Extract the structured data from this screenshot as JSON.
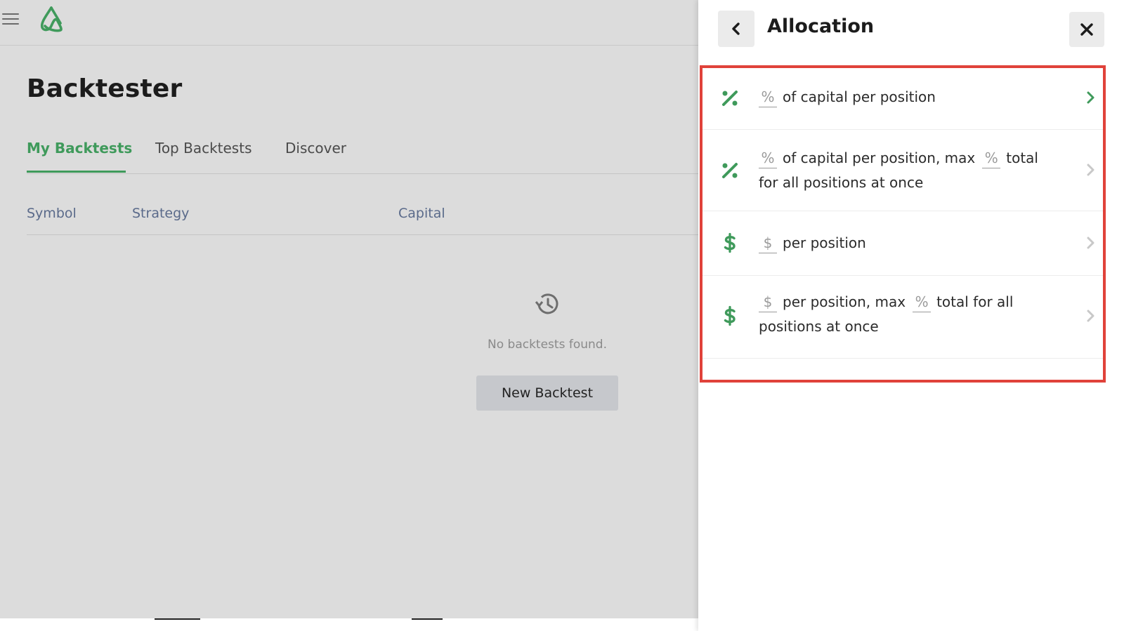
{
  "app": {
    "page_title": "Backtester",
    "tabs": [
      {
        "label": "My Backtests",
        "active": true
      },
      {
        "label": "Top Backtests",
        "active": false
      },
      {
        "label": "Discover",
        "active": false
      }
    ],
    "columns": [
      "Symbol",
      "Strategy",
      "Capital"
    ],
    "empty_message": "No backtests found.",
    "new_button_label": "New Backtest"
  },
  "panel": {
    "title": "Allocation",
    "options": [
      {
        "icon": "percent-icon",
        "parts": [
          "%",
          "of capital per position"
        ],
        "active": true
      },
      {
        "icon": "percent-icon",
        "parts": [
          "%",
          "of capital per position, max",
          "%",
          "total for all positions at once"
        ],
        "active": false
      },
      {
        "icon": "dollar-icon",
        "parts": [
          "$",
          "per position"
        ],
        "active": false
      },
      {
        "icon": "dollar-icon",
        "parts": [
          "$",
          "per position, max",
          "%",
          "total for all positions at once"
        ],
        "active": false
      }
    ]
  },
  "colors": {
    "accent": "#3f9a5b",
    "highlight_border": "#e0423a",
    "chevron_inactive": "#c8c8c8"
  }
}
